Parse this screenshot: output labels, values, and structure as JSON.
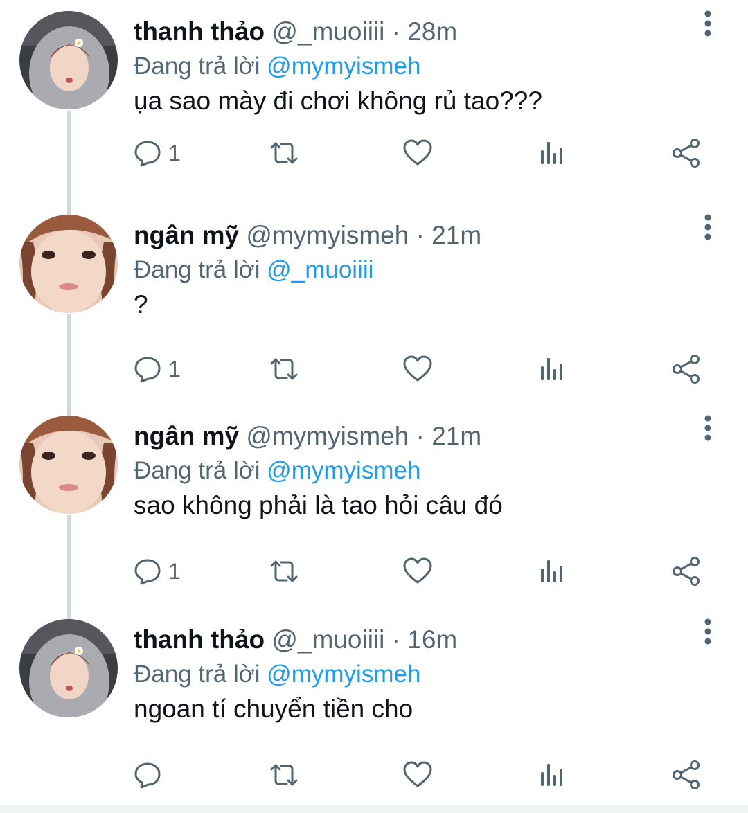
{
  "tweets": [
    {
      "name": "thanh thảo",
      "handle": "@_muoiiii",
      "separator": "·",
      "time": "28m",
      "reply_prefix": "Đang trả lời",
      "reply_to": "@mymyismeh",
      "text": "ụa sao mày đi chơi không rủ tao???",
      "reply_count": "1"
    },
    {
      "name": "ngân mỹ",
      "handle": "@mymyismeh",
      "separator": "·",
      "time": "21m",
      "reply_prefix": "Đang trả lời",
      "reply_to": "@_muoiiii",
      "text": "?",
      "reply_count": "1"
    },
    {
      "name": "ngân mỹ",
      "handle": "@mymyismeh",
      "separator": "·",
      "time": "21m",
      "reply_prefix": "Đang trả lời",
      "reply_to": "@mymyismeh",
      "text": "sao không phải là tao hỏi câu đó",
      "reply_count": "1"
    },
    {
      "name": "thanh thảo",
      "handle": "@_muoiiii",
      "separator": "·",
      "time": "16m",
      "reply_prefix": "Đang trả lời",
      "reply_to": "@mymyismeh",
      "text": "ngoan tí chuyển tiền cho",
      "reply_count": ""
    }
  ],
  "icons": {
    "more": "more-vertical-icon",
    "reply": "reply-icon",
    "retweet": "retweet-icon",
    "like": "heart-icon",
    "views": "views-icon",
    "share": "share-icon"
  },
  "colors": {
    "text": "#0f1419",
    "muted": "#536471",
    "mention": "#1d9bf0",
    "thread_line": "#cfd9de"
  }
}
